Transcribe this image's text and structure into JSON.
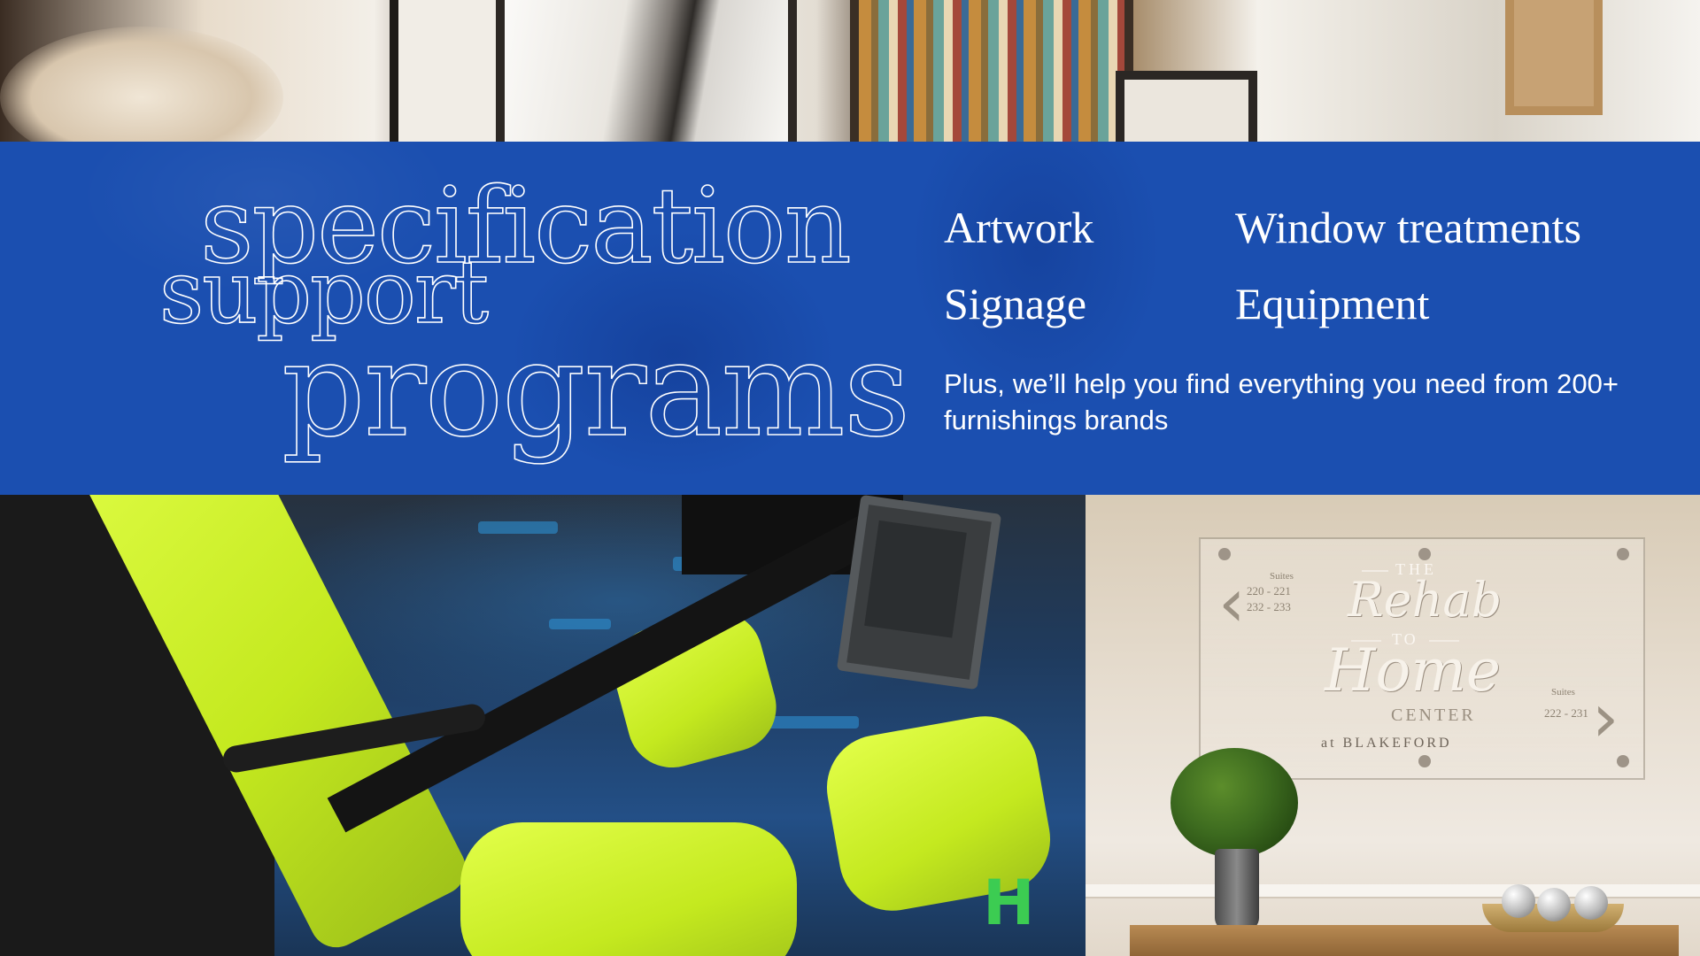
{
  "headline": {
    "line1": "specification",
    "line2": "support",
    "line3": "programs"
  },
  "categories": {
    "artwork": "Artwork",
    "window_treatments": "Window treatments",
    "signage": "Signage",
    "equipment": "Equipment"
  },
  "blurb": "Plus, we’ll help you find everything you need from 200+ furnishings brands",
  "sign": {
    "the": "THE",
    "rehab": "Rehab",
    "to": "TO",
    "home": "Home",
    "center": "CENTER",
    "at_blakeford": "at BLAKEFORD",
    "left_suites_label": "Suites",
    "left_suites": [
      "220 - 221",
      "232 - 233"
    ],
    "right_suites_label": "Suites",
    "right_suites": [
      "222 - 231"
    ]
  },
  "colors": {
    "band_blue": "#1b4fb0",
    "lime": "#d4f530",
    "white": "#ffffff"
  }
}
